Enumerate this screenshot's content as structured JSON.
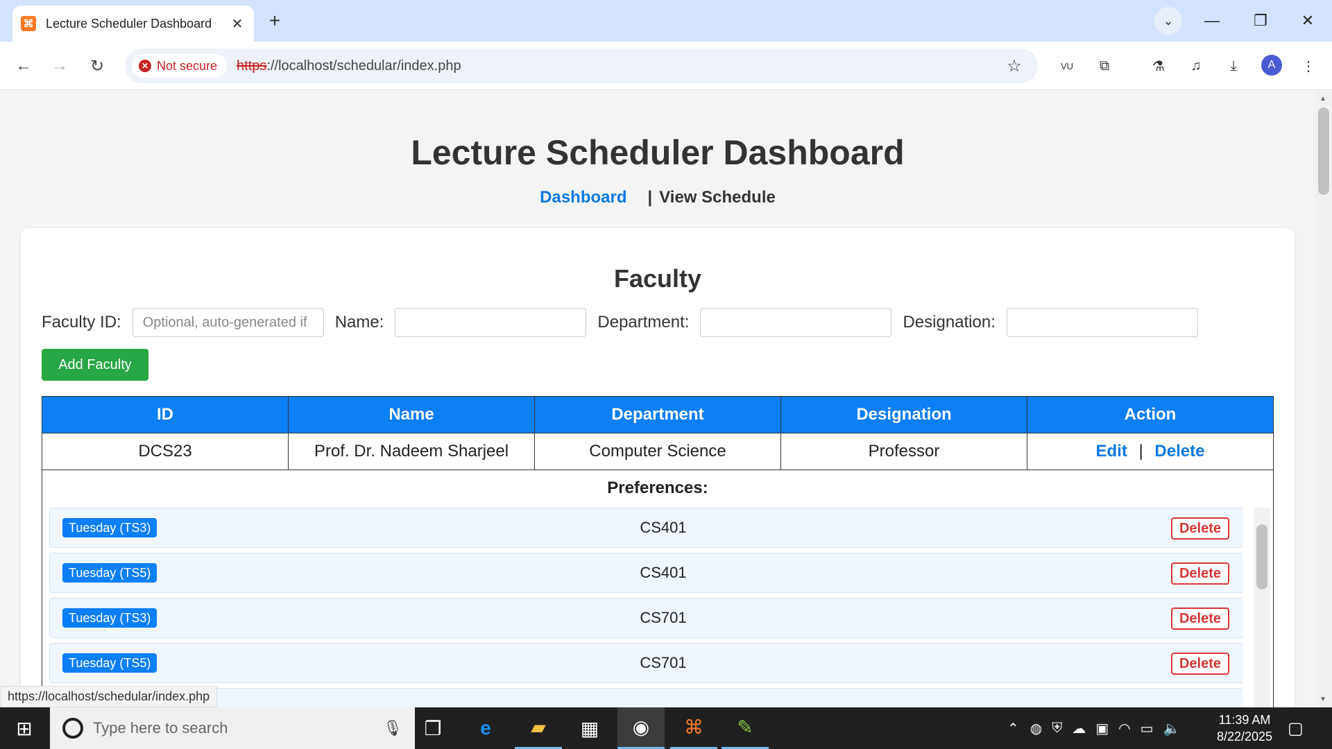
{
  "browser": {
    "tab_title": "Lecture Scheduler Dashboard",
    "security_label": "Not secure",
    "url_scheme": "https",
    "url_rest": "://localhost/schedular/index.php",
    "profile_initial": "A",
    "ext_vu_label": "VU",
    "status_url": "https://localhost/schedular/index.php"
  },
  "page": {
    "title": "Lecture Scheduler Dashboard",
    "nav": {
      "dashboard": "Dashboard",
      "separator": "|",
      "view_schedule": "View Schedule"
    }
  },
  "faculty": {
    "heading": "Faculty",
    "form": {
      "id_label": "Faculty ID:",
      "id_placeholder": "Optional, auto-generated if",
      "name_label": "Name:",
      "department_label": "Department:",
      "designation_label": "Designation:",
      "add_button": "Add Faculty"
    },
    "table": {
      "headers": [
        "ID",
        "Name",
        "Department",
        "Designation",
        "Action"
      ],
      "rows": [
        {
          "id": "DCS23",
          "name": "Prof. Dr. Nadeem Sharjeel",
          "department": "Computer Science",
          "designation": "Professor",
          "edit": "Edit",
          "sep": "|",
          "delete": "Delete"
        }
      ]
    },
    "preferences": {
      "title": "Preferences:",
      "items": [
        {
          "slot": "Tuesday (TS3)",
          "course": "CS401",
          "delete": "Delete"
        },
        {
          "slot": "Tuesday (TS5)",
          "course": "CS401",
          "delete": "Delete"
        },
        {
          "slot": "Tuesday (TS3)",
          "course": "CS701",
          "delete": "Delete"
        },
        {
          "slot": "Tuesday (TS5)",
          "course": "CS701",
          "delete": "Delete"
        }
      ]
    }
  },
  "taskbar": {
    "search_placeholder": "Type here to search",
    "time": "11:39 AM",
    "date": "8/22/2025"
  },
  "colors": {
    "primary": "#0b7ff5",
    "success": "#28a745",
    "danger": "#d93535"
  }
}
